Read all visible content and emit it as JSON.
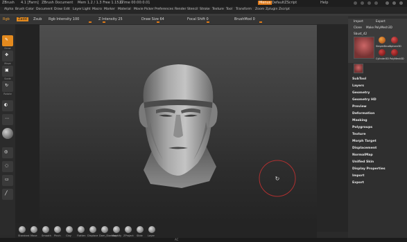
{
  "titlebar": {
    "app": "ZBrush",
    "version": "4.1 [Farm]",
    "document": "ZBrush Document",
    "mem": "Mem 1.2 / 1.3 Free 1.15 G",
    "timer": "ZTime 00:00:0.01",
    "menus_button": "Menus",
    "default_script": "DefaultZScript",
    "help": "Help"
  },
  "menubar": {
    "items": [
      "Alpha",
      "Brush",
      "Color",
      "Document",
      "Draw",
      "Edit",
      "Layer",
      "Light",
      "Macro",
      "Marker",
      "Material",
      "Movie",
      "Picker",
      "Preferences",
      "Render",
      "Stencil",
      "Stroke",
      "Texture",
      "Tool",
      "Transform",
      "Zoom",
      "Zplugin",
      "Zscript"
    ]
  },
  "toolbar": {
    "rgb": "Rgb",
    "zadd": "Zadd",
    "zsub": "Zsub",
    "rgb_intensity": "Rgb Intensity 100",
    "z_intensity": "Z Intensity 25",
    "draw_size": "Draw Size 64",
    "focal_shift": "Focal Shift 0",
    "brush_mod": "BrushMod 0"
  },
  "lefttools": {
    "items": [
      {
        "label": "Draw",
        "icon": "draw-icon"
      },
      {
        "label": "Move",
        "icon": "move-icon"
      },
      {
        "label": "Scale",
        "icon": "scale-icon"
      },
      {
        "label": "Rotate",
        "icon": "rotate-icon"
      },
      {
        "label": "",
        "icon": "brush-preview-icon"
      },
      {
        "label": "",
        "icon": "alpha-icon"
      },
      {
        "label": "",
        "icon": "material-icon"
      },
      {
        "label": "",
        "icon": "xyz-icon"
      },
      {
        "label": "",
        "icon": "lasso-icon"
      },
      {
        "label": "",
        "icon": "frame-icon"
      },
      {
        "label": "",
        "icon": "line-icon"
      }
    ]
  },
  "rightpanel": {
    "tabs": [
      "Import",
      "Export"
    ],
    "buttons": [
      "Clone",
      "Make PolyMesh3D"
    ],
    "tool_name": "Sbust_42",
    "subtools": [
      "SimpleBrush",
      "Sphere3D",
      "Cylinder3D",
      "PolyMesh3D"
    ],
    "menu": [
      "SubTool",
      "Layers",
      "Geometry",
      "Geometry HD",
      "Preview",
      "Deformation",
      "Masking",
      "Polygroups",
      "Texture",
      "Morph Target",
      "Displacement",
      "NormalMap",
      "Unified Skin",
      "Display Properties",
      "Import",
      "Export"
    ]
  },
  "brushbar": {
    "items": [
      "Standard",
      "Move",
      "Smooth",
      "Pinch",
      "Clay",
      "Flatten",
      "Displace",
      "Dam_Standard",
      "Magnify",
      "ZProject",
      "Slide",
      "Layer"
    ]
  },
  "footer": {
    "text": "AC"
  }
}
